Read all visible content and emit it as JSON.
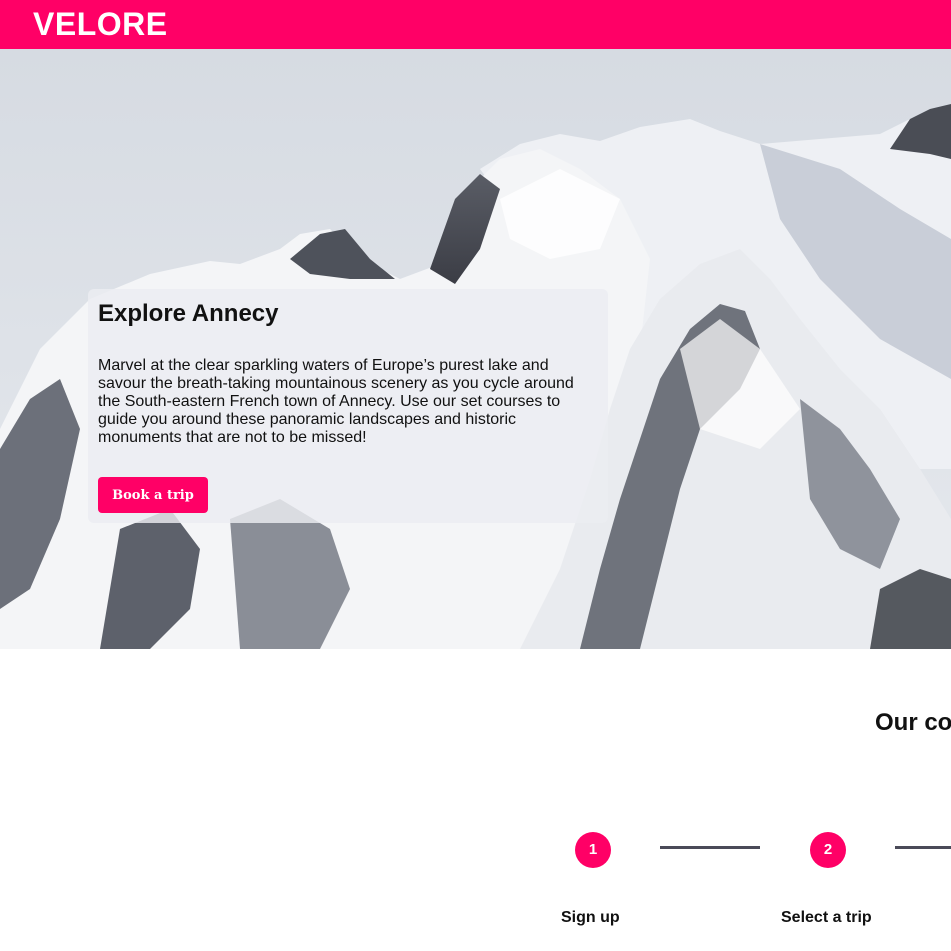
{
  "header": {
    "brand": "VELORE",
    "brand_color": "#ff0066"
  },
  "hero": {
    "image": "snowy-mountains-image",
    "card": {
      "title": "Explore Annecy",
      "text": "Marvel at the clear sparkling waters of Europe’s purest lake and savour the breath-taking mountainous scenery as you cycle around the South-eastern French town of Annecy. Use our set courses to guide you around these panoramic landscapes and historic monuments that are not to be missed!",
      "button_label": "Book a trip"
    }
  },
  "courses": {
    "title": "Our co",
    "steps": [
      {
        "number": "1",
        "label": "Sign up"
      },
      {
        "number": "2",
        "label": "Select a trip"
      }
    ]
  }
}
